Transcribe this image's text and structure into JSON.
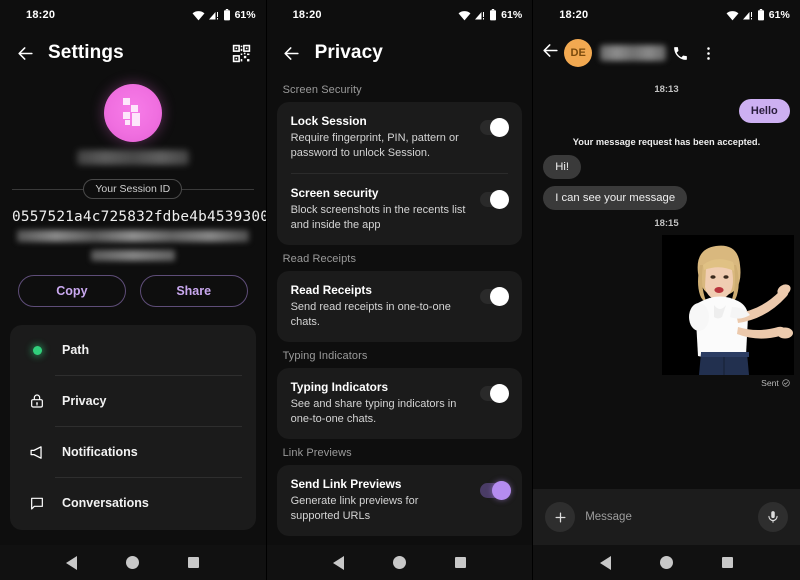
{
  "status_bar": {
    "time": "18:20",
    "battery": "61%",
    "wifi_icon": "wifi-icon",
    "signal_icon": "signal-icon",
    "battery_icon": "battery-icon"
  },
  "panel_settings": {
    "title": "Settings",
    "back_icon": "back-arrow-icon",
    "qr_icon": "qr-code-icon",
    "avatar": "profile-avatar",
    "session_id_label": "Your Session ID",
    "session_id": "0557521a4c725832fdbe4b4539300",
    "copy_label": "Copy",
    "share_label": "Share",
    "menu": [
      {
        "label": "Path",
        "icon": "status-dot-icon"
      },
      {
        "label": "Privacy",
        "icon": "lock-icon"
      },
      {
        "label": "Notifications",
        "icon": "megaphone-icon"
      },
      {
        "label": "Conversations",
        "icon": "chat-box-icon"
      }
    ]
  },
  "panel_privacy": {
    "title": "Privacy",
    "back_icon": "back-arrow-icon",
    "sections": [
      {
        "heading": "Screen Security",
        "items": [
          {
            "title": "Lock Session",
            "desc": "Require fingerprint, PIN, pattern or password to unlock Session.",
            "toggle": "off"
          },
          {
            "title": "Screen security",
            "desc": "Block screenshots in the recents list and inside the app",
            "toggle": "off"
          }
        ]
      },
      {
        "heading": "Read Receipts",
        "items": [
          {
            "title": "Read Receipts",
            "desc": "Send read receipts in one-to-one chats.",
            "toggle": "off"
          }
        ]
      },
      {
        "heading": "Typing Indicators",
        "items": [
          {
            "title": "Typing Indicators",
            "desc": "See and share typing indicators in one-to-one chats.",
            "toggle": "off"
          }
        ]
      },
      {
        "heading": "Link Previews",
        "items": [
          {
            "title": "Send Link Previews",
            "desc": "Generate link previews for supported URLs",
            "toggle": "on"
          }
        ]
      }
    ]
  },
  "panel_chat": {
    "back_icon": "back-arrow-icon",
    "avatar_initials": "DE",
    "call_icon": "phone-icon",
    "overflow_icon": "more-vertical-icon",
    "timestamp_top": "18:13",
    "outgoing_message": "Hello",
    "system_message": "Your message request has been accepted.",
    "incoming_messages": [
      "Hi!",
      "I can see your message"
    ],
    "timestamp_mid": "18:15",
    "sticker_name": "person-sticker-image",
    "sent_label": "Sent",
    "sent_icon": "check-circle-icon",
    "composer_attach_icon": "plus-icon",
    "composer_placeholder": "Message",
    "composer_mic_icon": "microphone-icon"
  },
  "nav_bar": {
    "back_icon": "nav-back-triangle",
    "home_icon": "nav-home-circle",
    "recents_icon": "nav-recents-square"
  },
  "colors": {
    "accent_purple": "#b58cf0",
    "bubble_out": "#cdb0f2",
    "bubble_in": "#3a3a3a",
    "avatar_pink": "#f06fe0",
    "avatar_orange": "#f2a951",
    "online_green": "#31d07c",
    "background": "#0e0e0e",
    "card": "#1b1b1b"
  }
}
